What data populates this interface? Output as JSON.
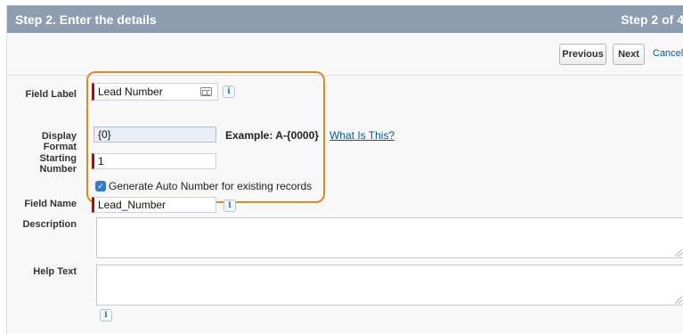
{
  "header": {
    "title": "Step 2. Enter the details",
    "step": "Step 2 of 4"
  },
  "buttons": {
    "previous": "Previous",
    "next": "Next",
    "cancel": "Cancel"
  },
  "fields": {
    "field_label": {
      "label": "Field Label",
      "value": "Lead Number"
    },
    "display_format": {
      "label_line1": "Display",
      "label_line2": "Format",
      "value": "{0}",
      "example_label": "Example:",
      "example_value": "A-{0000}",
      "help_link": "What Is This?"
    },
    "starting_number": {
      "label_line1": "Starting",
      "label_line2": "Number",
      "value": "1"
    },
    "generate_auto": {
      "label": "Generate Auto Number for existing records",
      "checked": true
    },
    "field_name": {
      "label": "Field Name",
      "value": "Lead_Number"
    },
    "description": {
      "label": "Description",
      "value": ""
    },
    "help_text": {
      "label": "Help Text",
      "value": ""
    }
  },
  "icons": {
    "info": "i",
    "check": "✓"
  },
  "colors": {
    "header_bg": "#8e9eb1",
    "required_bar": "#cc0000",
    "highlight": "#e08a1f",
    "link": "#015ba7"
  }
}
